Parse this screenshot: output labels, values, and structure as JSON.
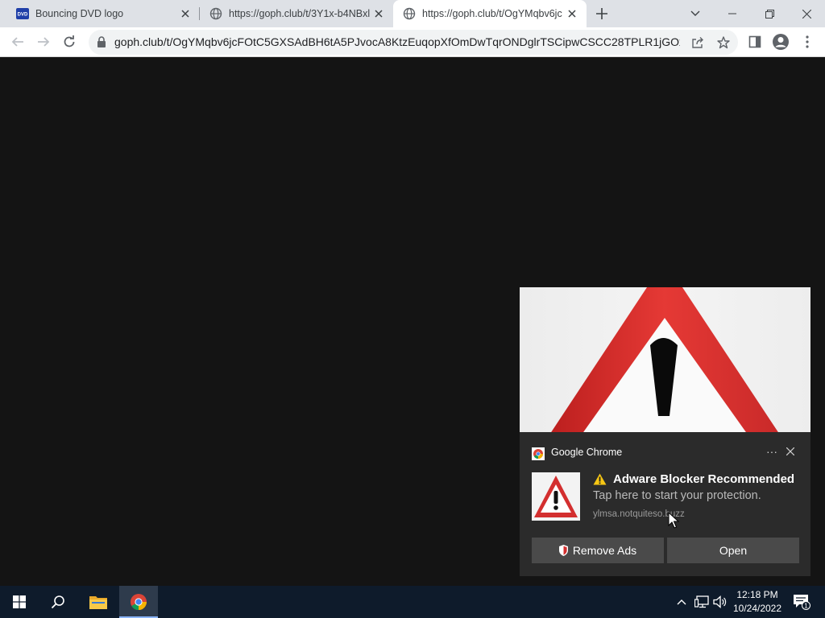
{
  "browser": {
    "tabs": [
      {
        "title": "Bouncing DVD logo",
        "favicon": "dvd-logo-icon",
        "active": false
      },
      {
        "title": "https://goph.club/t/3Y1x-b4NBxl",
        "favicon": "globe-icon",
        "active": false
      },
      {
        "title": "https://goph.club/t/OgYMqbv6jc",
        "favicon": "globe-icon",
        "active": true
      }
    ],
    "url": "goph.club/t/OgYMqbv6jcFOtC5GXSAdBH6tA5PJvocA8KtzEuqopXfOmDwTqrONDglrTSCipwCSCC28TPLR1jGOxOr..."
  },
  "notification": {
    "app_name": "Google Chrome",
    "more_label": "···",
    "title": "Adware Blocker Recommended",
    "body": "Tap here to start your protection.",
    "source": "ylmsa.notquiteso.buzz",
    "buttons": [
      "Remove Ads",
      "Open"
    ]
  },
  "taskbar": {
    "time": "12:18 PM",
    "date": "10/24/2022",
    "notification_count": "1"
  },
  "colors": {
    "page_background": "#141414",
    "toast_background": "#2b2b2b",
    "warning_red": "#d22b2b",
    "taskbar": "#0e1b2b"
  }
}
